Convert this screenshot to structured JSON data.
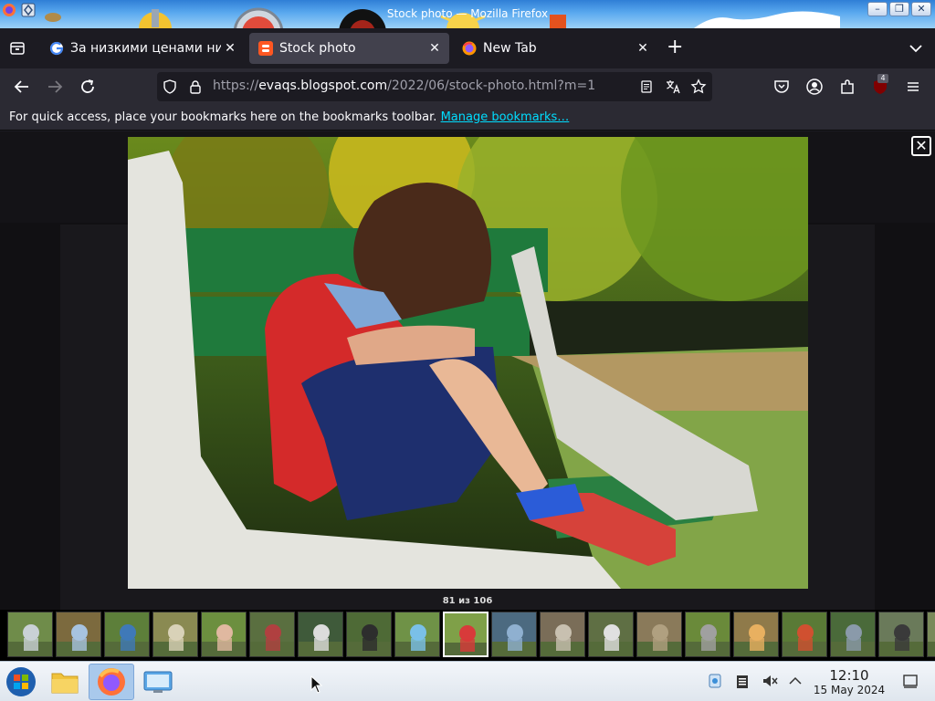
{
  "window": {
    "title": "Stock photo — Mozilla Firefox",
    "controls": [
      "–",
      "❐",
      "✕"
    ]
  },
  "tabs": [
    {
      "label": "За низкими ценами ни",
      "favicon": "google-icon",
      "active": false
    },
    {
      "label": "Stock photo",
      "favicon": "blogger-icon",
      "active": true
    },
    {
      "label": "New Tab",
      "favicon": "firefox-icon",
      "active": false
    }
  ],
  "url": {
    "prefix": "https://",
    "domain": "evaqs.blogspot.com",
    "path": "/2022/06/stock-photo.html?m=1"
  },
  "bookmarks_bar": {
    "message": "For quick access, place your bookmarks here on the bookmarks toolbar.",
    "link": "Manage bookmarks…"
  },
  "extensions_badge": "4",
  "lightbox": {
    "counter": "81 из 106",
    "close_label": "✕",
    "thumbnail_count": 20,
    "selected_index": 9
  },
  "taskbar": {
    "time": "12:10",
    "date": "15 May 2024"
  },
  "colors": {
    "accent_link": "#00ddff",
    "toolbar": "#2b2a33",
    "tabstrip": "#1c1b22"
  }
}
